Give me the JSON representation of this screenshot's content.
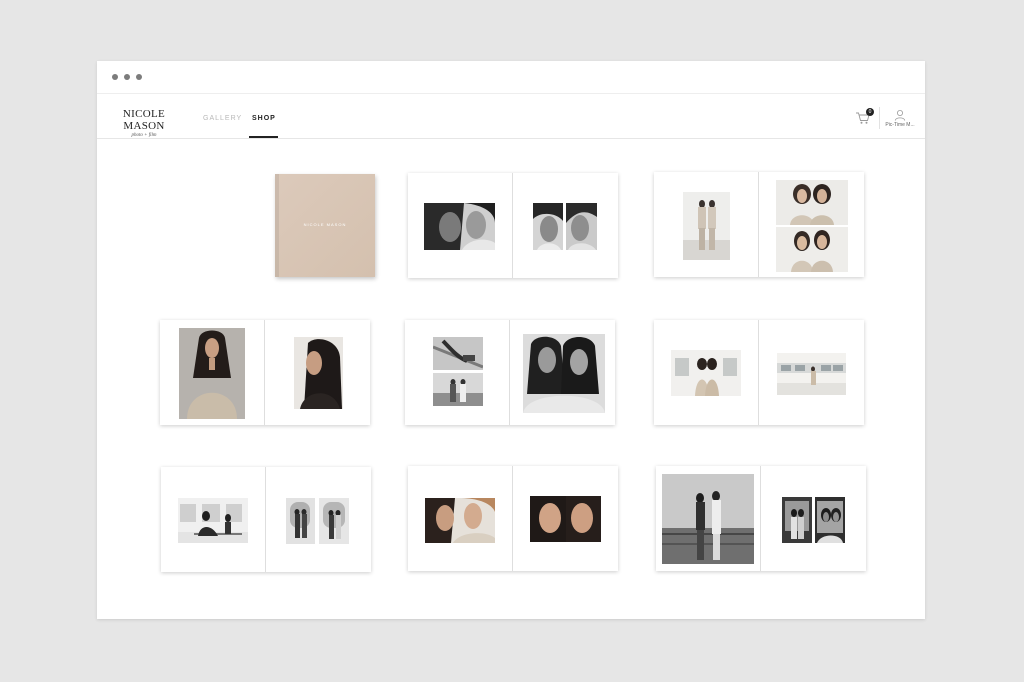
{
  "brand": {
    "name": "NICOLE MASON",
    "subtitle": "photo + film"
  },
  "nav": {
    "gallery": "GALLERY",
    "shop": "SHOP",
    "active": "shop"
  },
  "cart": {
    "icon": "cart-icon",
    "count": "0"
  },
  "user": {
    "icon": "user-icon",
    "label": "Pic-Time M..."
  },
  "cover": {
    "title": "NICOLE MASON",
    "color": "#d9c6b5"
  },
  "spreads": [
    {
      "left": "bw-two-women-close",
      "right": "bw-two-portraits"
    },
    {
      "left": "full-length-pair",
      "right": "color-pair-stacked"
    },
    {
      "left": "color-curly-hair-portrait",
      "right": "color-profile-portrait"
    },
    {
      "left": "bw-detail-stack",
      "right": "bw-two-women"
    },
    {
      "left": "color-ferry-window",
      "right": "color-ferry-deck"
    },
    {
      "left": "bw-ferry-railing",
      "right": "bw-ferry-pair-diptych"
    },
    {
      "left": "color-two-women-close",
      "right": "color-faces-close"
    },
    {
      "left": "bw-seaside-pair",
      "right": "bw-pair-diptych"
    }
  ],
  "colors": {
    "background": "#e6e6e6",
    "window": "#ffffff",
    "accent": "#222222",
    "muted": "#b8b8b8"
  }
}
